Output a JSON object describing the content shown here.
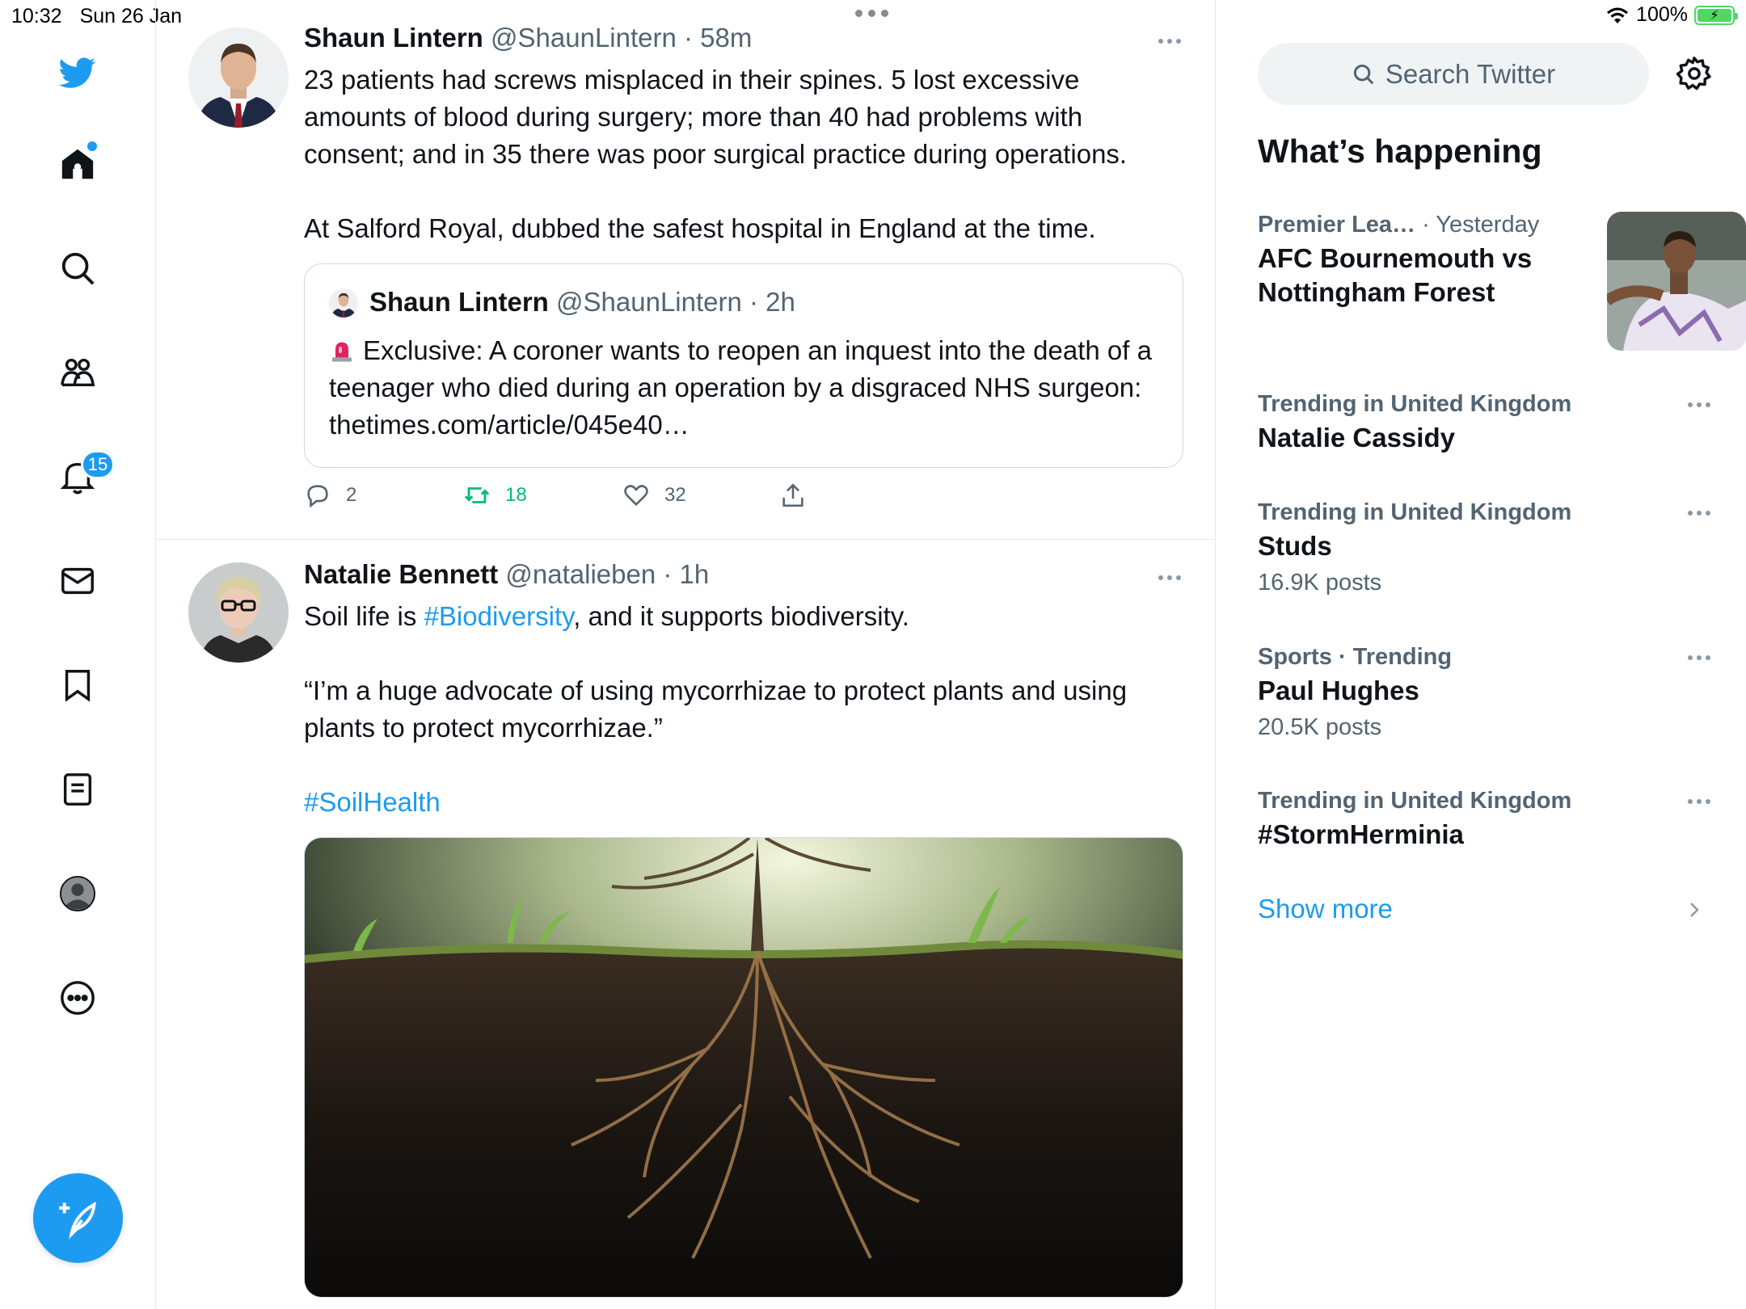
{
  "status_bar": {
    "time": "10:32",
    "date": "Sun 26 Jan",
    "battery_percent": "100%",
    "battery_level": 1.0
  },
  "nav": {
    "notifications_badge": "15",
    "items": [
      "twitter-logo-icon",
      "home-icon",
      "search-icon",
      "communities-icon",
      "notifications-icon",
      "messages-icon",
      "bookmarks-icon",
      "lists-icon",
      "profile-icon",
      "more-icon",
      "compose-icon"
    ]
  },
  "tweets": [
    {
      "name": "Shaun Lintern",
      "handle": "@ShaunLintern",
      "time": "· 58m",
      "text_1": "23 patients had screws misplaced in their spines. 5 lost excessive amounts of blood during surgery; more than 40 had problems with consent; and in 35 there was poor surgical practice during operations.",
      "text_2": "At Salford Royal, dubbed the safest hospital in England at the time.",
      "quote": {
        "name": "Shaun Lintern",
        "handle": "@ShaunLintern",
        "time": "· 2h",
        "text": "Exclusive: A coroner wants to reopen an inquest into the death of a teenager who died during an operation by a disgraced NHS surgeon: thetimes.com/article/045e40…"
      },
      "replies": "2",
      "retweets": "18",
      "likes": "32"
    },
    {
      "name": "Natalie Bennett",
      "handle": "@natalieben",
      "time": "· 1h",
      "text_pre": "Soil life is ",
      "hashtag_1": "#Biodiversity",
      "text_post": ", and it supports biodiversity.",
      "quote_text": "“I’m a huge advocate of using mycorrhizae to protect plants and using plants to protect mycorrhizae.”",
      "hashtag_2": "#SoilHealth"
    }
  ],
  "sidebar": {
    "search_placeholder": "Search Twitter",
    "whats_happening": "What’s happening",
    "featured": {
      "category": "Premier Lea…",
      "time": "· Yesterday",
      "title": "AFC Bournemouth vs Nottingham Forest"
    },
    "trends": [
      {
        "meta": "Trending in United Kingdom",
        "title": "Natalie Cassidy",
        "count": ""
      },
      {
        "meta": "Trending in United Kingdom",
        "title": "Studs",
        "count": "16.9K posts"
      },
      {
        "meta": "Sports · Trending",
        "title": "Paul Hughes",
        "count": "20.5K posts"
      },
      {
        "meta": "Trending in United Kingdom",
        "title": "#StormHerminia",
        "count": ""
      }
    ],
    "show_more": "Show more"
  },
  "colors": {
    "accent": "#1d9bf0",
    "retweet": "#00ba7c",
    "secondary_text": "#536471",
    "border": "#e7e9ea"
  }
}
